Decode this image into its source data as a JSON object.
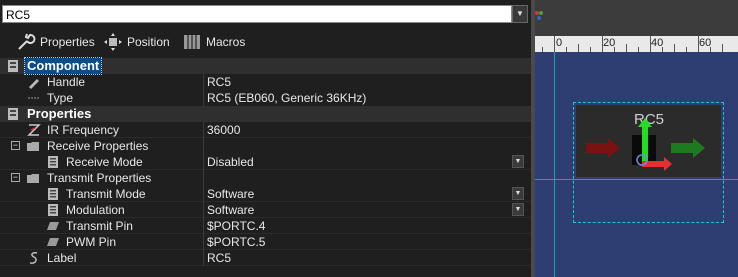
{
  "selector": {
    "value": "RC5"
  },
  "toolbar": {
    "properties_label": "Properties",
    "position_label": "Position",
    "macros_label": "Macros"
  },
  "sections": {
    "component": "Component",
    "properties": "Properties"
  },
  "rows": {
    "handle": {
      "name": "Handle",
      "value": "RC5"
    },
    "type": {
      "name": "Type",
      "value": "RC5 (EB060, Generic 36KHz)"
    },
    "ir_frequency": {
      "name": "IR Frequency",
      "value": "36000"
    },
    "receive_properties": {
      "name": "Receive Properties"
    },
    "receive_mode": {
      "name": "Receive Mode",
      "value": "Disabled"
    },
    "transmit_properties": {
      "name": "Transmit Properties"
    },
    "transmit_mode": {
      "name": "Transmit Mode",
      "value": "Software"
    },
    "modulation": {
      "name": "Modulation",
      "value": "Software"
    },
    "transmit_pin": {
      "name": "Transmit Pin",
      "value": "$PORTC.4"
    },
    "pwm_pin": {
      "name": "PWM Pin",
      "value": "$PORTC.5"
    },
    "label": {
      "name": "Label",
      "value": "RC5"
    }
  },
  "canvas": {
    "ruler_labels": [
      "0",
      "20",
      "40",
      "60"
    ],
    "component_label": "RC5"
  },
  "colors": {
    "accent": "#0b4c8a",
    "canvas": "#2f3e72",
    "guide": "#15a6a6"
  }
}
